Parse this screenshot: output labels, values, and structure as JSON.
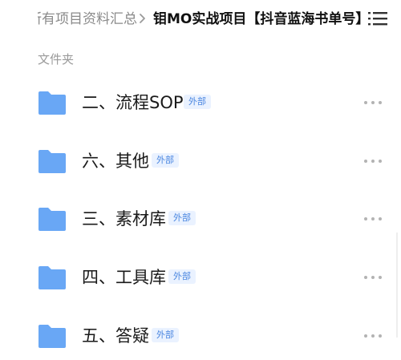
{
  "breadcrumb": {
    "parent": "所有项目资料汇总",
    "current": "钼MO实战项目【抖音蓝海书单号】"
  },
  "section": {
    "label": "文件夹"
  },
  "folders": [
    {
      "name": "二、流程SOP",
      "tag": "外部"
    },
    {
      "name": "六、其他",
      "tag": "外部"
    },
    {
      "name": "三、素材库",
      "tag": "外部"
    },
    {
      "name": "四、工具库",
      "tag": "外部"
    },
    {
      "name": "五、答疑",
      "tag": "外部"
    }
  ],
  "icons": {
    "folder": "folder-icon",
    "more": "more-icon",
    "menu": "menu-list-icon",
    "separator": "chevron-right-icon"
  },
  "colors": {
    "folder": "#69a7f5",
    "tag_bg": "#eaf2ff",
    "tag_text": "#4a86e0",
    "muted_text": "#9a9a9a"
  }
}
